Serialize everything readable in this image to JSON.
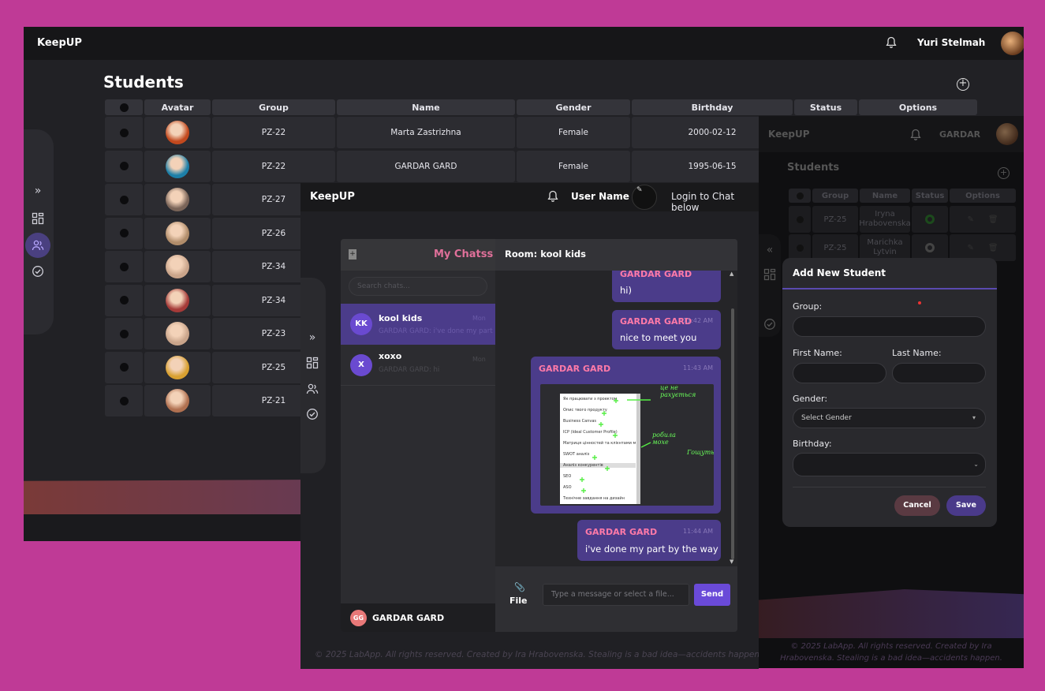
{
  "winA": {
    "brand": "KeepUP",
    "user_name": "Yuri Stelmah",
    "title": "Students",
    "add_symbol": "+",
    "sidebar_collapse_icon": "»",
    "headers": [
      "",
      "Avatar",
      "Group",
      "Name",
      "Gender",
      "Birthday",
      "Status",
      "Options"
    ],
    "rows": [
      {
        "group": "PZ-22",
        "name": "Marta Zastrizhna",
        "gender": "Female",
        "birthday": "2000-02-12",
        "avatar_color": "#c2491e"
      },
      {
        "group": "PZ-22",
        "name": "GARDAR GARD",
        "gender": "Female",
        "birthday": "1995-06-15",
        "avatar_color": "#1c7fa8"
      },
      {
        "group": "PZ-27",
        "avatar_color": "#7a6458"
      },
      {
        "group": "PZ-26",
        "avatar_color": "#b08c6a"
      },
      {
        "group": "PZ-34",
        "avatar_color": "#c9a48a"
      },
      {
        "group": "PZ-34",
        "avatar_color": "#a53a38"
      },
      {
        "group": "PZ-23",
        "avatar_color": "#c9a48a"
      },
      {
        "group": "PZ-25",
        "avatar_color": "#d8a030"
      },
      {
        "group": "PZ-21",
        "avatar_color": "#b07050"
      }
    ]
  },
  "winB": {
    "brand": "KeepUP",
    "user_name": "User Name",
    "login_label": "Login to Chat below",
    "sidebar_collapse_icon": "»",
    "chat_list": {
      "add_symbol": "+",
      "title": "My Chatss",
      "search_placeholder": "Search chats...",
      "items": [
        {
          "initials": "KK",
          "name": "kool kids",
          "preview": "GARDAR GARD: i've done my part",
          "time": "Mon",
          "active": true
        },
        {
          "initials": "X",
          "name": "xoxo",
          "preview": "GARDAR GARD: hi",
          "time": "Mon",
          "active": false
        }
      ],
      "current_user_initials": "GG",
      "current_user_name": "GARDAR GARD"
    },
    "room": {
      "title": "Room: kool kids",
      "messages": [
        {
          "sender": "GARDAR GARD",
          "text": "hi)",
          "time": ""
        },
        {
          "sender": "GARDAR GARD",
          "text": "nice to meet you",
          "time": "11:42 AM"
        },
        {
          "sender": "GARDAR GARD",
          "text": "",
          "time": "11:43 AM",
          "image": true
        },
        {
          "sender": "GARDAR GARD",
          "text": "i've done my part by the way",
          "time": "11:44 AM"
        }
      ],
      "screenshot_doc_lines": [
        "Як працювати з проектом",
        "Опис твого продукту",
        "Business Canvas",
        "ICP (Ideal Customer Profile)",
        "Матриця цінностей та клієнтами м",
        "SWOT аналіз",
        "Аналіз конкурентів",
        "SEO",
        "ASO",
        "Технічне завдання на дизайн"
      ],
      "handwriting": [
        "це не рахується",
        "робила мохе",
        "Гощуть"
      ],
      "file_icon": "📎",
      "file_label": "File",
      "input_placeholder": "Type a message or select a file...",
      "send_label": "Send"
    },
    "footer": "© 2025 LabApp. All rights reserved. Created by Ira Hrabovenska. Stealing is a bad idea—accidents happen."
  },
  "winC": {
    "brand": "KeepUP",
    "user_name": "GARDAR",
    "title": "Students",
    "add_symbol": "+",
    "sidebar_collapse_icon": "«",
    "headers": [
      "",
      "Group",
      "Name",
      "Status",
      "Options"
    ],
    "rows": [
      {
        "group": "PZ-25",
        "name": "Iryna Hrabovenska"
      },
      {
        "group": "PZ-25",
        "name": "Marichka Lytvin"
      }
    ],
    "modal": {
      "title": "Add New Student",
      "group_label": "Group:",
      "first_name_label": "First Name:",
      "last_name_label": "Last Name:",
      "gender_label": "Gender:",
      "gender_value": "Select Gender",
      "birthday_label": "Birthday:",
      "cancel_label": "Cancel",
      "save_label": "Save"
    },
    "footer": "© 2025 LabApp. All rights reserved. Created by Ira Hrabovenska. Stealing is a bad idea—accidents happen."
  },
  "colors": {
    "background": "#bf3a96",
    "accent": "#6a4ad8",
    "sender_name": "#ff7aa8",
    "my_chats_title": "#e0709a",
    "bubble": "#4b3c8a"
  }
}
